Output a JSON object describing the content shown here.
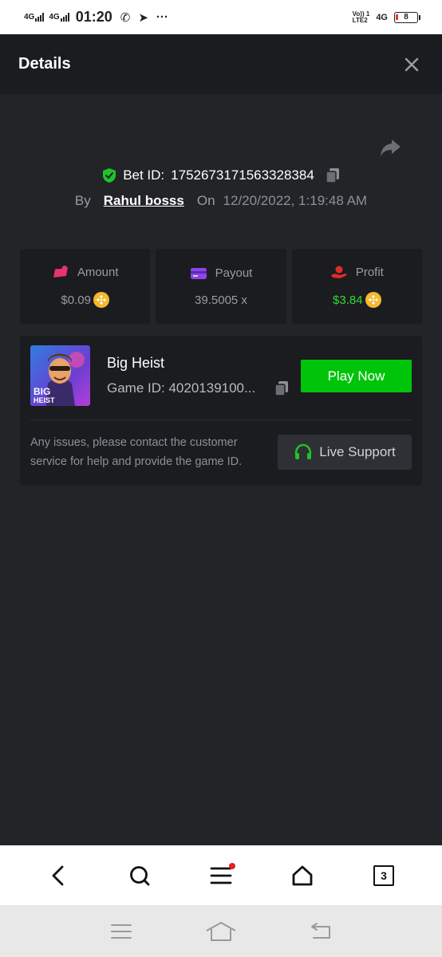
{
  "status_bar": {
    "signal1": "4G",
    "signal2": "4G",
    "time": "01:20",
    "right_label1": "Vo)) 1\nLTE2",
    "right_label2": "4G",
    "battery": "8"
  },
  "header": {
    "title": "Details"
  },
  "bet": {
    "label": "Bet ID:",
    "id": "1752673171563328384",
    "by_label": "By",
    "user": "Rahul bosss",
    "on_label": "On",
    "date": "12/20/2022, 1:19:48 AM"
  },
  "stats": {
    "amount": {
      "label": "Amount",
      "value": "$0.09"
    },
    "payout": {
      "label": "Payout",
      "value": "39.5005 x"
    },
    "profit": {
      "label": "Profit",
      "value": "$3.84"
    }
  },
  "game": {
    "name": "Big Heist",
    "id_label": "Game ID: 4020139100...",
    "thumb_text_1": "BIG",
    "thumb_text_2": "HEIST",
    "play_label": "Play Now",
    "help_text": "Any issues, please contact the customer service for help and provide the game ID.",
    "support_label": "Live Support"
  },
  "bottom_nav": {
    "tabs_count": "3"
  },
  "colors": {
    "accent_green": "#00c40a",
    "profit_green": "#2fdc2f",
    "coin": "#f3ba2f",
    "amount_icon": "#e8336d",
    "payout_icon": "#8b45e8",
    "profit_icon": "#e02b2b"
  }
}
